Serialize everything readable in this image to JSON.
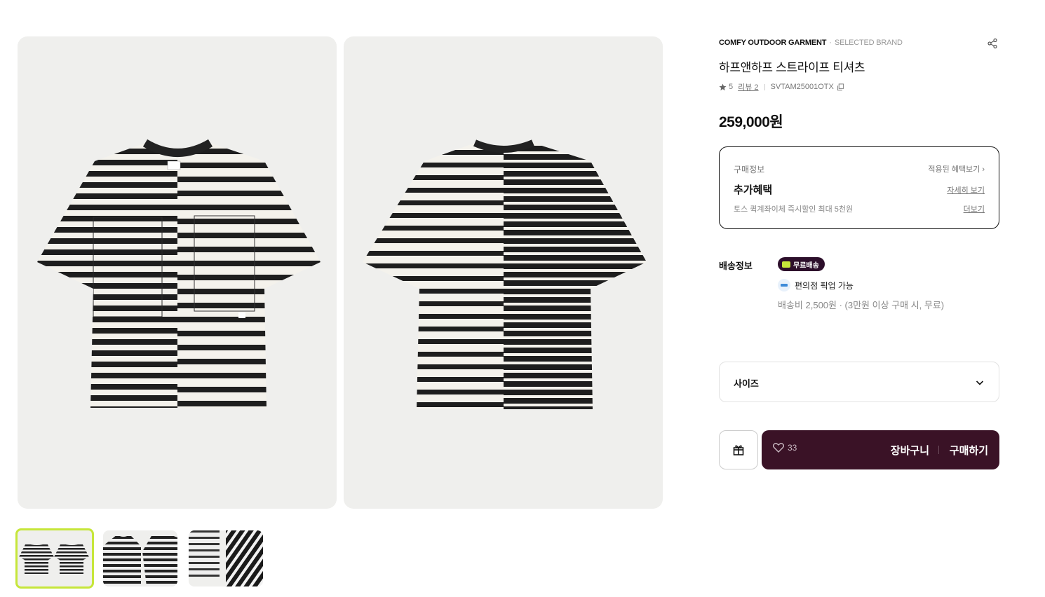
{
  "product": {
    "brand": "COMFY OUTDOOR GARMENT",
    "brand_dot": "·",
    "brand_tag": "SELECTED BRAND",
    "title": "하프앤하프 스트라이프 티셔츠",
    "rating": "5",
    "review_label": "리뷰 2",
    "sku": "SVTAM25001OTX",
    "price": "259,000원"
  },
  "benefits": {
    "label": "구매정보",
    "applied_link": "적용된 혜택보기 ›",
    "title": "추가혜택",
    "detail_link": "자세히 보기",
    "description": "토스 퀵계좌이체 즉시할인 최대 5천원",
    "more_link": "더보기"
  },
  "shipping": {
    "label": "배송정보",
    "free_badge": "무료배송",
    "pickup": "편의점 픽업 가능",
    "fee": "배송비 2,500원 · (3만원 이상 구매 시, 무료)"
  },
  "size_select": {
    "label": "사이즈"
  },
  "actions": {
    "like_count": "33",
    "cart_label": "장바구니",
    "buy_label": "구매하기"
  },
  "colors": {
    "accent": "#c6e63a",
    "buy_bar": "#3a1226",
    "image_bg": "#efefed"
  },
  "icons": [
    "share-icon",
    "star-icon",
    "copy-icon",
    "chevron-down-icon",
    "gift-icon",
    "heart-icon",
    "truck-icon",
    "pickup-icon"
  ]
}
